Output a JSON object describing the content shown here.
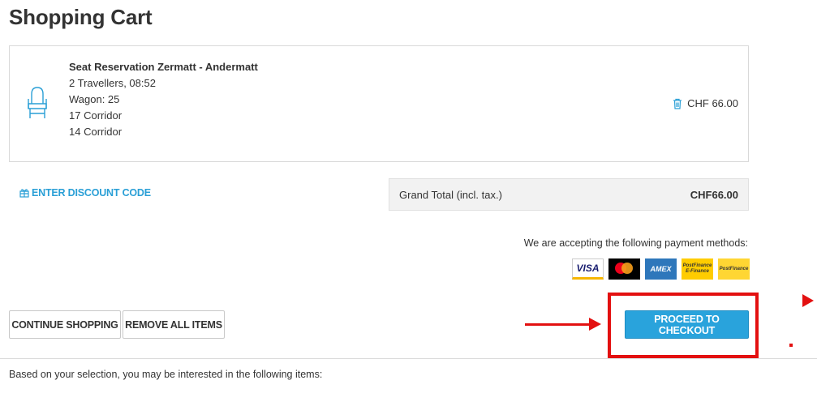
{
  "page": {
    "title": "Shopping Cart"
  },
  "cart_item": {
    "icon": "chair-icon",
    "title": "Seat Reservation Zermatt - Andermatt",
    "lines": [
      "2 Travellers, 08:52",
      "Wagon: 25",
      "17 Corridor",
      "14 Corridor"
    ],
    "delete_icon": "trash-icon",
    "price": "CHF 66.00"
  },
  "discount": {
    "icon": "gift-icon",
    "label": "ENTER DISCOUNT CODE"
  },
  "grand_total": {
    "label": "Grand Total (incl. tax.)",
    "value": "CHF66.00"
  },
  "payment": {
    "text": "We are accepting the following payment methods:",
    "methods": [
      {
        "name": "VISA",
        "label": "VISA"
      },
      {
        "name": "Mastercard",
        "label": ""
      },
      {
        "name": "AMEX",
        "label": "AMEX"
      },
      {
        "name": "PostFinance E-Finance",
        "label": "PostFinance E-Finance"
      },
      {
        "name": "PostFinance Card",
        "label": "PostFinance"
      }
    ]
  },
  "buttons": {
    "continue": "CONTINUE SHOPPING",
    "remove_all": "REMOVE ALL ITEMS",
    "checkout": "PROCEED TO CHECKOUT"
  },
  "suggestions": {
    "text": "Based on your selection, you may be interested in the following items:"
  },
  "colors": {
    "accent": "#29a3dc",
    "annotation": "#e31010",
    "link": "#2a9fd6"
  }
}
